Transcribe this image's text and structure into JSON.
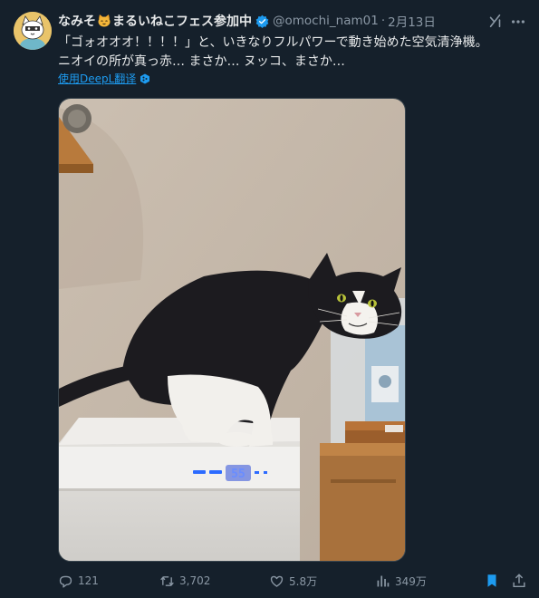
{
  "author": {
    "display_name_before": "なみそ",
    "display_name_after": "まるいねこフェス参加中",
    "handle": "@omochi_nam01",
    "separator": "·",
    "date": "2月13日"
  },
  "tweet": {
    "line1": "「ゴォオオオ！！！！」と、いきなりフルパワーで動き始めた空気清浄機。",
    "line2": "ニオイの所が真っ赤… まさか… ヌッコ、まさか…"
  },
  "translate": {
    "label": "使用DeepL翻译"
  },
  "air_purifier_display": "55",
  "actions": {
    "replies": "121",
    "retweets": "3,702",
    "likes": "5.8万",
    "views": "349万"
  },
  "colors": {
    "background": "#15202b",
    "accent": "#1d9bf0",
    "muted": "#8b98a5",
    "text": "#e7e9ea"
  },
  "icons": {
    "verified": "verified-badge-icon",
    "grok": "grok-icon",
    "more": "more-icon",
    "deepl": "deepl-icon",
    "reply": "reply-icon",
    "retweet": "retweet-icon",
    "like": "heart-icon",
    "views": "views-icon",
    "bookmark": "bookmark-icon",
    "share": "share-icon"
  }
}
